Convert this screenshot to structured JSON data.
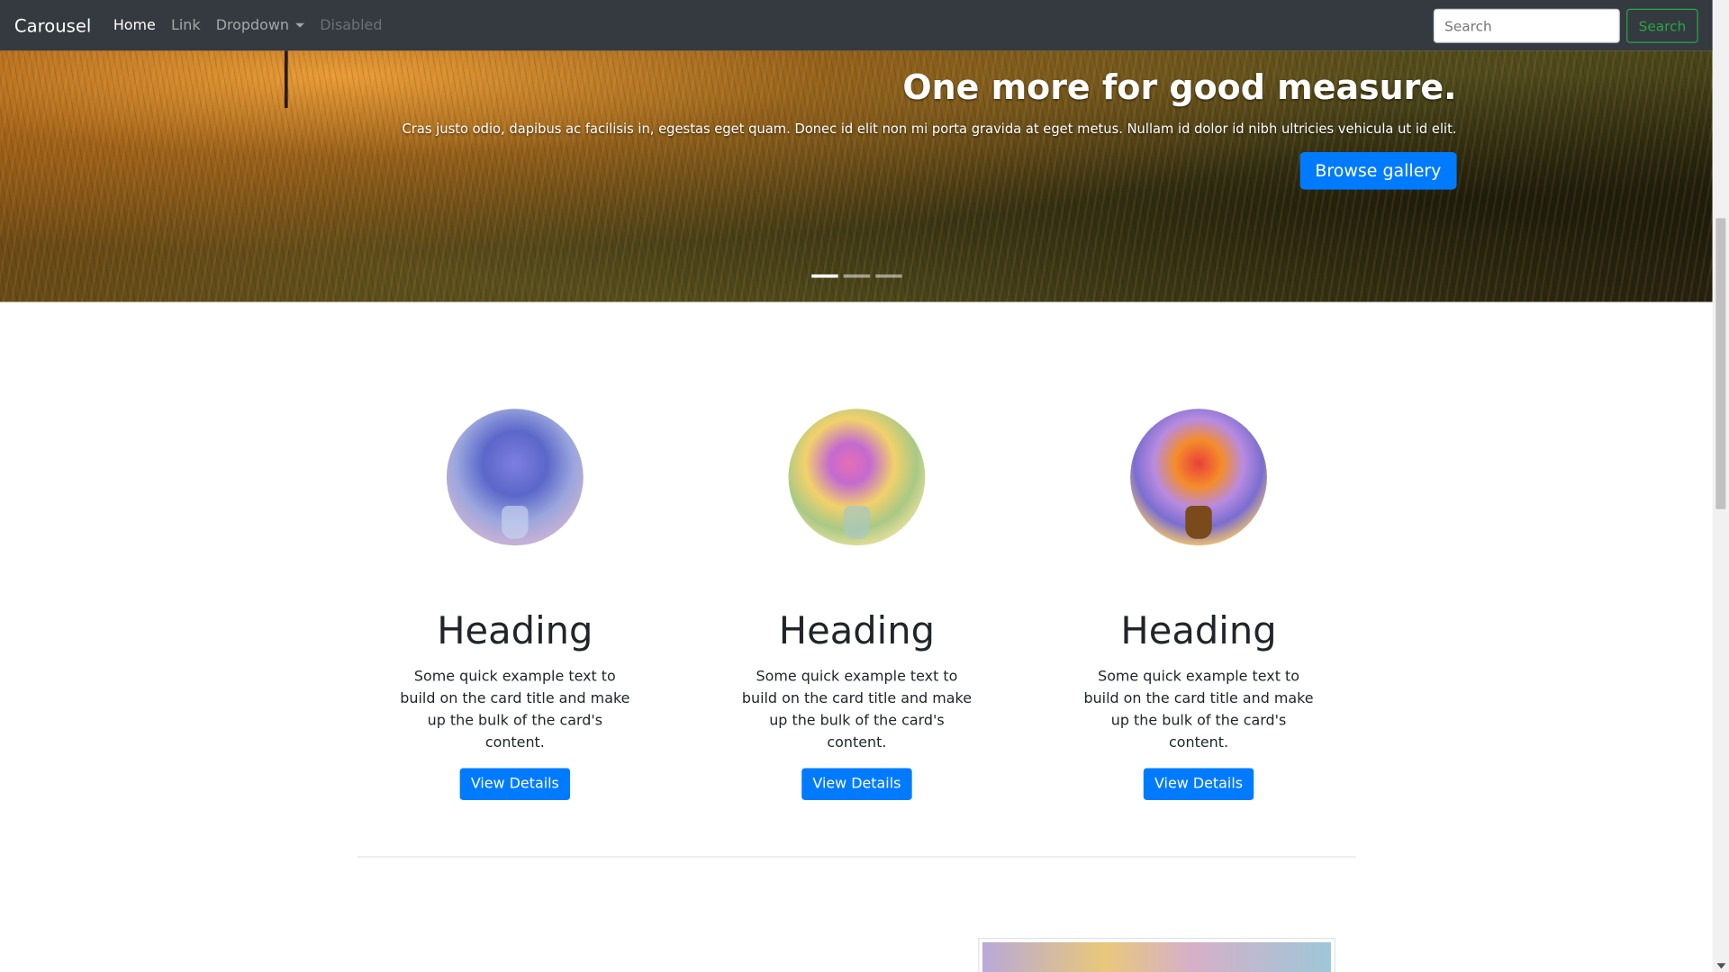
{
  "navbar": {
    "brand": "Carousel",
    "links": [
      "Home",
      "Link",
      "Dropdown",
      "Disabled"
    ],
    "search_placeholder": "Search",
    "search_button": "Search"
  },
  "carousel": {
    "heading": "One more for good measure.",
    "text": "Cras justo odio, dapibus ac facilisis in, egestas eget quam. Donec id elit non mi porta gravida at eget metus. Nullam id dolor id nibh ultricies vehicula ut id elit.",
    "button": "Browse gallery",
    "active_slide": 1,
    "slide_count": 3
  },
  "columns": [
    {
      "heading": "Heading",
      "text": "Some quick example text to build on the card title and make up the bulk of the card's content.",
      "button": "View Details"
    },
    {
      "heading": "Heading",
      "text": "Some quick example text to build on the card title and make up the bulk of the card's content.",
      "button": "View Details"
    },
    {
      "heading": "Heading",
      "text": "Some quick example text to build on the card title and make up the bulk of the card's content.",
      "button": "View Details"
    }
  ],
  "colors": {
    "navbar_bg": "#343a40",
    "primary": "#007bff",
    "success": "#28a745"
  }
}
